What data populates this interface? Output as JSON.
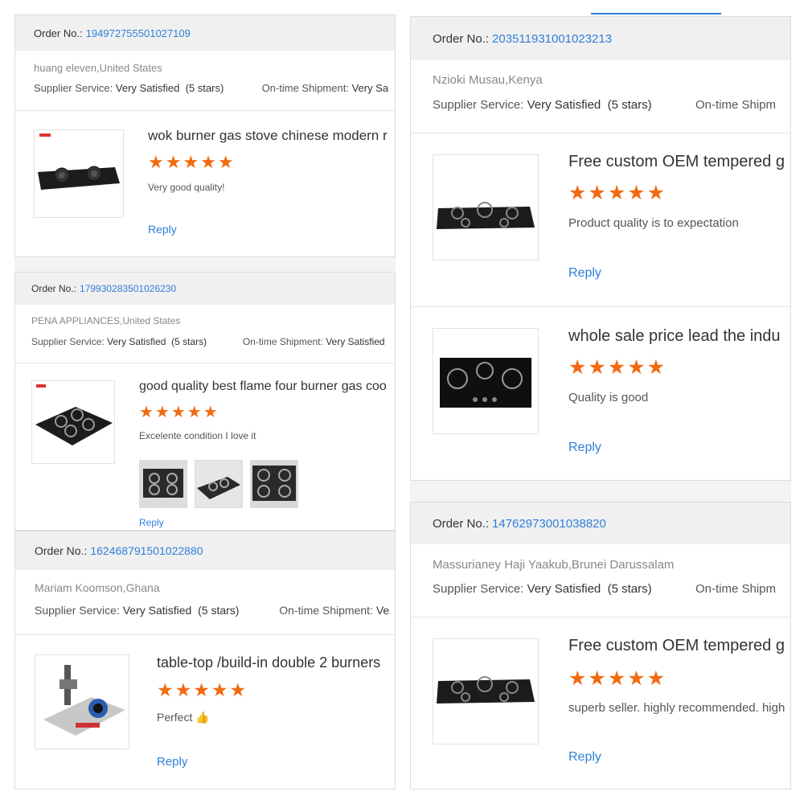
{
  "common": {
    "order_label": "Order No.:",
    "supplier_label": "Supplier Service:",
    "shipment_label": "On-time Shipment:",
    "reply": "Reply",
    "stars": "★★★★★"
  },
  "reviews": [
    {
      "order_no": "194972755501027109",
      "buyer": "huang eleven,United States",
      "supplier_value": "Very Satisfied",
      "supplier_stars": "(5 stars)",
      "shipment_value": "Very Sa",
      "product_title": "wok burner gas stove chinese modern r",
      "comment": "Very good quality!"
    },
    {
      "order_no": "179930283501026230",
      "buyer": "PENA APPLIANCES,United States",
      "supplier_value": "Very Satisfied",
      "supplier_stars": "(5 stars)",
      "shipment_value": "Very Satisfied",
      "product_title": "good quality best flame four burner gas coo",
      "comment": "Excelente condition I love it"
    },
    {
      "order_no": "162468791501022880",
      "buyer": "Mariam Koomson,Ghana",
      "supplier_value": "Very Satisfied",
      "supplier_stars": "(5 stars)",
      "shipment_value": "Ve",
      "product_title": "table-top /build-in double 2 burners",
      "comment": "Perfect",
      "comment_emoji": "👍"
    },
    {
      "order_no": "203511931001023213",
      "buyer": "Nzioki Musau,Kenya",
      "supplier_value": "Very Satisfied",
      "supplier_stars": "(5 stars)",
      "shipment_label_cut": "On-time Shipm",
      "items": [
        {
          "product_title": "Free custom OEM tempered g",
          "comment": "Product quality is to expectation"
        },
        {
          "product_title": "whole sale price lead the indu",
          "comment": "Quality is good"
        }
      ]
    },
    {
      "order_no": "14762973001038820",
      "buyer": "Massurianey Haji Yaakub,Brunei Darussalam",
      "supplier_value": "Very Satisfied",
      "supplier_stars": "(5 stars)",
      "shipment_label_cut": "On-time Shipm",
      "product_title": "Free custom OEM tempered g",
      "comment": "superb seller. highly recommended. high"
    }
  ],
  "colors": {
    "link": "#2f7fd9",
    "star": "#f26a10",
    "header_bg": "#f0f0f0"
  }
}
